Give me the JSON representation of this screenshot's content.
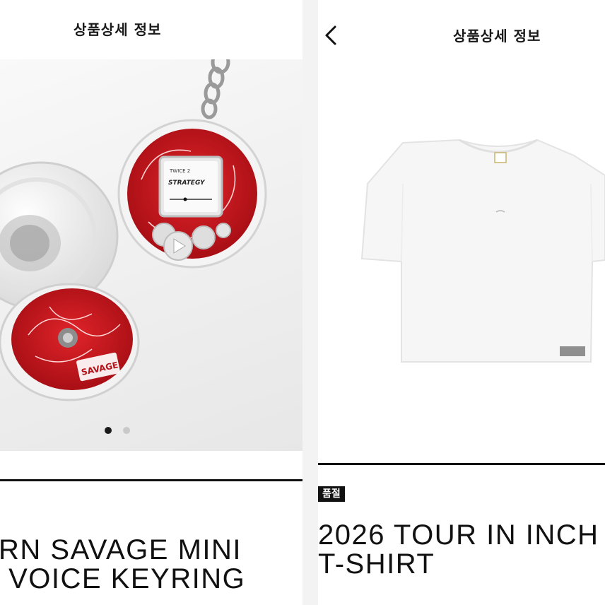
{
  "left_panel": {
    "header_title": "상품상세 정보",
    "carousel": {
      "current": 1,
      "total": 2
    },
    "product_title_line1": "RN SAVAGE MINI",
    "product_title_line2": "P VOICE KEYRING",
    "image_text": {
      "screen_label": "TWICE 2",
      "screen_logo": "STRATEGY",
      "case_logo": "SAVAGE"
    }
  },
  "right_panel": {
    "header_title": "상품상세 정보",
    "badge": "품절",
    "product_title_line1": "2026 TOUR IN INCH",
    "product_title_line2": "T-SHIRT"
  },
  "colors": {
    "accent_red": "#c8141b",
    "text_dark": "#111111",
    "badge_bg": "#111111"
  },
  "icons": {
    "back": "chevron-left-icon"
  }
}
